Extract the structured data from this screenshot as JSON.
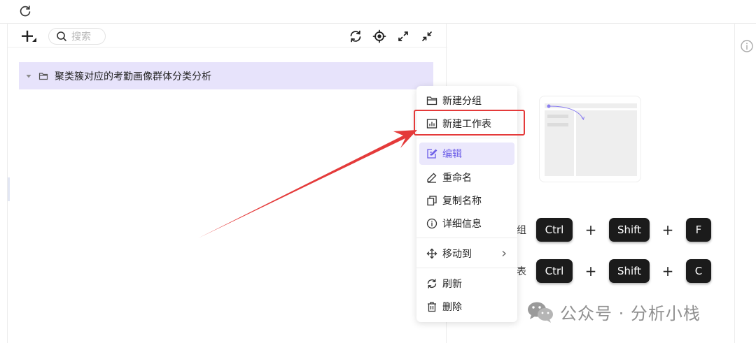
{
  "toolbar": {
    "search_placeholder": "搜索"
  },
  "tree": {
    "folder_label": "聚类簇对应的考勤画像群体分类分析"
  },
  "context_menu": {
    "items": [
      {
        "label": "新建分组",
        "icon": "folder-icon"
      },
      {
        "label": "新建工作表",
        "icon": "chart-sheet-icon"
      },
      {
        "label": "编辑",
        "icon": "edit-icon",
        "active": true
      },
      {
        "label": "重命名",
        "icon": "pencil-icon"
      },
      {
        "label": "复制名称",
        "icon": "copy-icon"
      },
      {
        "label": "详细信息",
        "icon": "info-icon"
      },
      {
        "label": "移动到",
        "icon": "move-icon",
        "submenu": true
      },
      {
        "label": "刷新",
        "icon": "refresh-icon"
      },
      {
        "label": "删除",
        "icon": "trash-icon"
      }
    ]
  },
  "shortcuts": [
    {
      "label_fragment": "组",
      "keys": [
        "Ctrl",
        "Shift",
        "F"
      ],
      "separator": "+"
    },
    {
      "label_fragment": "表",
      "keys": [
        "Ctrl",
        "Shift",
        "C"
      ],
      "separator": "+"
    }
  ],
  "watermark": {
    "text": "公众号 · 分析小栈"
  },
  "colors": {
    "accent": "#6b5ce7",
    "selected_row_bg": "#e7e3fb",
    "highlight_red": "#e43a3a",
    "key_bg": "#1b1b1b"
  }
}
